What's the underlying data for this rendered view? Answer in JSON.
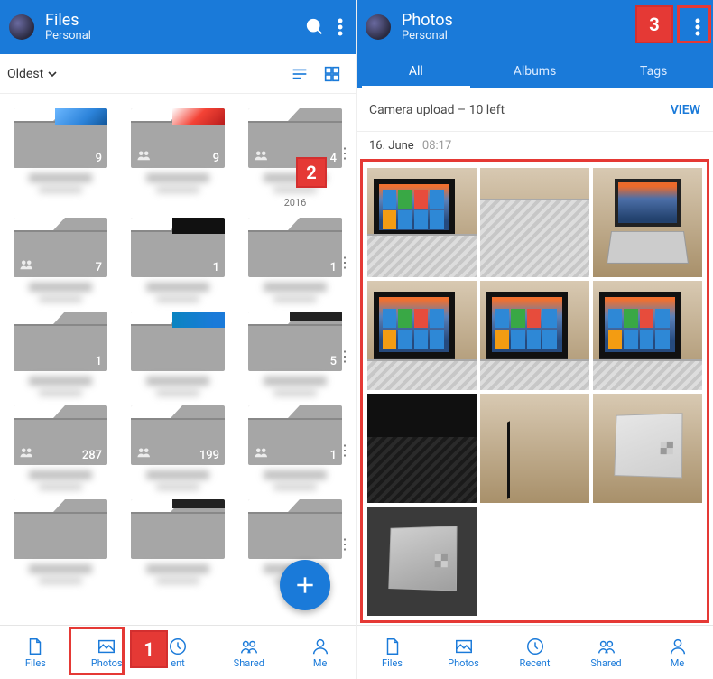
{
  "left": {
    "header": {
      "title": "Files",
      "subtitle": "Personal"
    },
    "sort_label": "Oldest",
    "folders": [
      {
        "count": "9",
        "shared": false,
        "preview": "fp-blue"
      },
      {
        "count": "9",
        "shared": true,
        "preview": "fp-red"
      },
      {
        "count": "4",
        "shared": true,
        "preview": ""
      },
      {
        "count": "7",
        "shared": true,
        "preview": ""
      },
      {
        "count": "1",
        "shared": false,
        "preview": "fp-black"
      },
      {
        "count": "1",
        "shared": false,
        "preview": ""
      },
      {
        "count": "1",
        "shared": false,
        "preview": ""
      },
      {
        "count": "",
        "shared": false,
        "preview": "fp-teal"
      },
      {
        "count": "5",
        "shared": false,
        "preview": "fp-dark"
      },
      {
        "count": "287",
        "shared": true,
        "preview": ""
      },
      {
        "count": "199",
        "shared": true,
        "preview": ""
      },
      {
        "count": "1",
        "shared": true,
        "preview": ""
      },
      {
        "count": "",
        "shared": false,
        "preview": ""
      },
      {
        "count": "",
        "shared": false,
        "preview": "fp-dark"
      },
      {
        "count": "",
        "shared": false,
        "preview": ""
      }
    ],
    "visible_text_fragment": "2016",
    "nav": {
      "files": "Files",
      "photos": "Photos",
      "recent": "ent",
      "shared": "Shared",
      "me": "Me"
    }
  },
  "right": {
    "header": {
      "title": "Photos",
      "subtitle": "Personal"
    },
    "tabs": {
      "all": "All",
      "albums": "Albums",
      "tags": "Tags"
    },
    "upload_status": "Camera upload – 10 left",
    "view_label": "VIEW",
    "date": "16. June",
    "time": "08:17",
    "nav": {
      "files": "Files",
      "photos": "Photos",
      "recent": "Recent",
      "shared": "Shared",
      "me": "Me"
    }
  },
  "callouts": {
    "one": "1",
    "two": "2",
    "three": "3"
  }
}
